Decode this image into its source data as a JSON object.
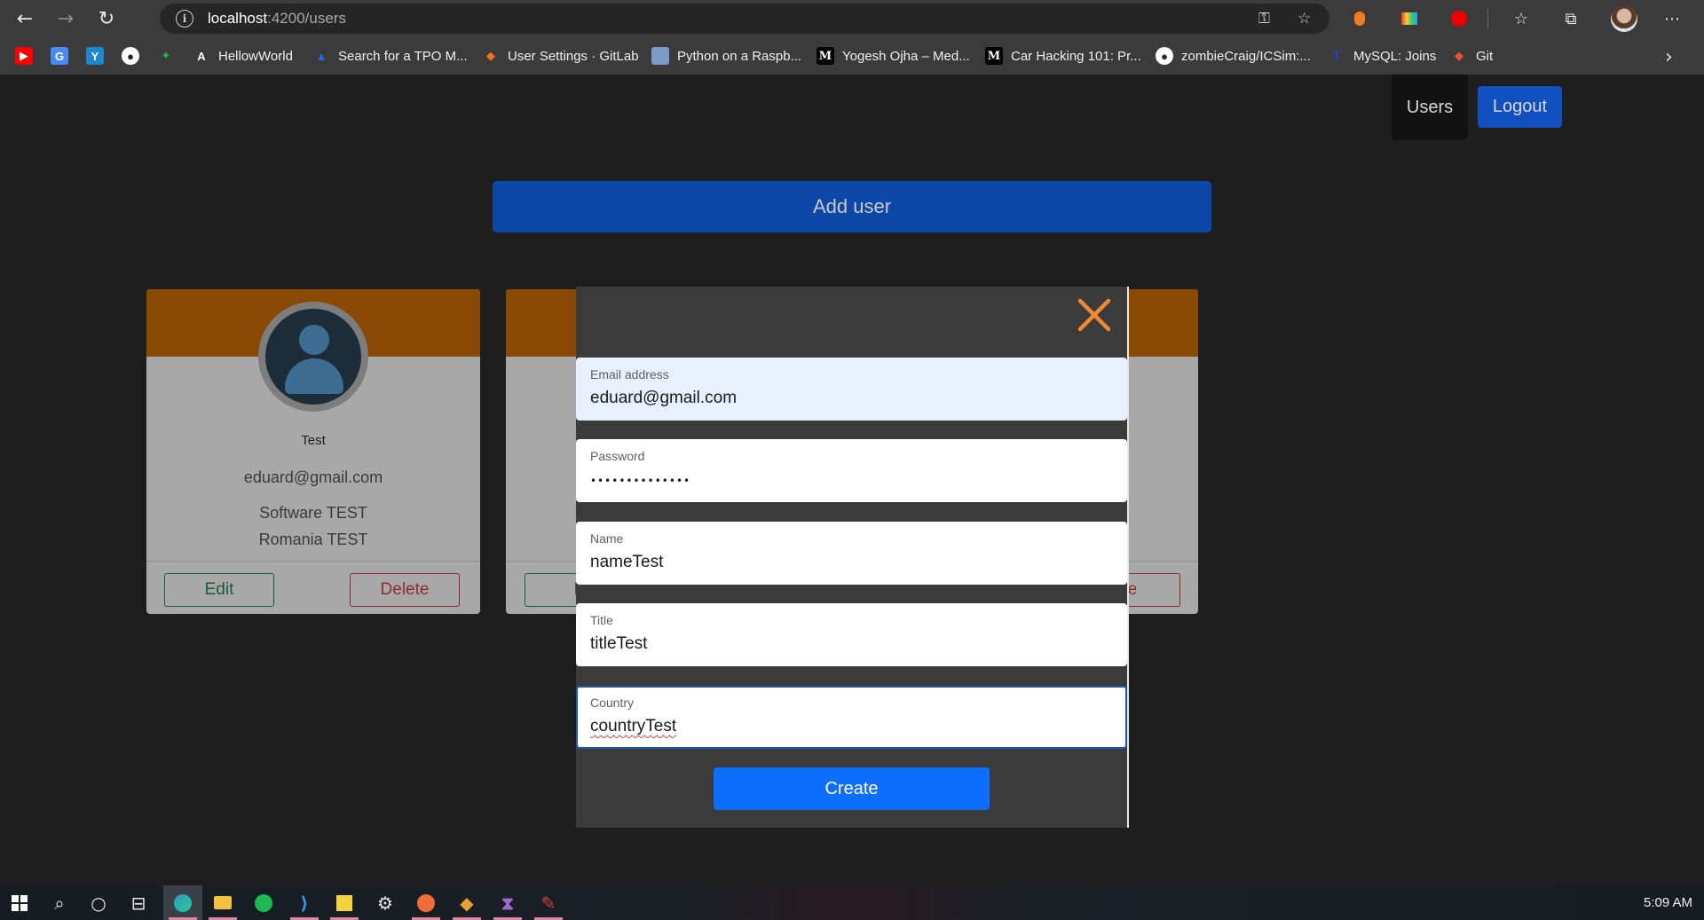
{
  "browser": {
    "url_host": "localhost",
    "url_path": ":4200/users",
    "back_icon": "arrow-left-icon",
    "forward_icon": "arrow-right-icon",
    "refresh_icon": "refresh-icon"
  },
  "bookmarks": [
    {
      "label": "",
      "icon": "youtube-icon",
      "color": "#ff0000"
    },
    {
      "label": "",
      "icon": "google-translate-icon",
      "color": "#4a8af4"
    },
    {
      "label": "",
      "icon": "yammer-icon",
      "color": "#1da1f2"
    },
    {
      "label": "",
      "icon": "github-icon",
      "color": "#ffffff"
    },
    {
      "label": "",
      "icon": "leaf-icon",
      "color": "#2bb24c"
    },
    {
      "label": "HellowWorld",
      "icon": "a-icon",
      "color": "#ffffff"
    },
    {
      "label": "Search for a TPO M...",
      "icon": "triangle-icon",
      "color": "#1d6fe0"
    },
    {
      "label": "User Settings · GitLab",
      "icon": "gitlab-icon",
      "color": "#fc6d26"
    },
    {
      "label": "Python on a Raspb...",
      "icon": "image-icon",
      "color": "#7a9bc7"
    },
    {
      "label": "Yogesh Ojha – Med...",
      "icon": "medium-icon",
      "color": "#000000"
    },
    {
      "label": "Car Hacking 101: Pr...",
      "icon": "medium-icon",
      "color": "#000000"
    },
    {
      "label": "zombieCraig/ICSim:...",
      "icon": "github-icon",
      "color": "#ffffff"
    },
    {
      "label": "MySQL: Joins",
      "icon": "t-icon",
      "color": "#2c3ec8"
    },
    {
      "label": "Git",
      "icon": "git-icon",
      "color": "#f05133"
    }
  ],
  "nav": {
    "users_label": "Users",
    "logout_label": "Logout"
  },
  "page": {
    "add_user_label": "Add user"
  },
  "cards": [
    {
      "name": "Test",
      "email": "eduard@gmail.com",
      "title": "Software TEST",
      "country": "Romania TEST",
      "edit_label": "Edit",
      "delete_label": "Delete"
    },
    {
      "edit_label": "E",
      "delete_label": "ete"
    }
  ],
  "modal": {
    "close_icon": "close-x-icon",
    "fields": [
      {
        "label": "Email address",
        "value": "eduard@gmail.com"
      },
      {
        "label": "Password",
        "value": "••••••••••••••"
      },
      {
        "label": "Name",
        "value": "nameTest"
      },
      {
        "label": "Title",
        "value": "titleTest"
      },
      {
        "label": "Country",
        "value": "countryTest"
      }
    ],
    "create_label": "Create"
  },
  "taskbar": {
    "time": "5:09 AM",
    "apps": [
      "windows-start-icon",
      "search-icon",
      "cortana-icon",
      "task-view-icon",
      "edge-icon",
      "file-explorer-icon",
      "spotify-icon",
      "vscode-icon",
      "sticky-notes-icon",
      "settings-icon",
      "postman-icon",
      "git-icon",
      "visual-studio-icon",
      "paint-icon"
    ]
  },
  "colors": {
    "accent_blue": "#0d6efd",
    "card_band": "#8a4a05",
    "close_orange": "#f08a30"
  }
}
